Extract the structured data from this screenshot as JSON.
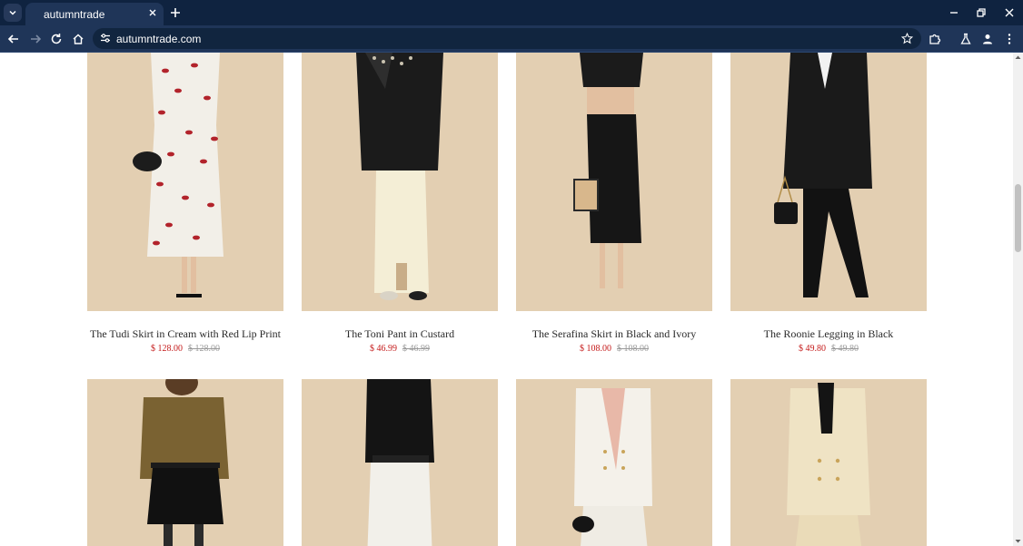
{
  "browser": {
    "tab_title": "autumntrade",
    "url": "autumntrade.com"
  },
  "products": [
    {
      "name": "The Tudi Skirt in Cream with Red Lip Print",
      "price": "$ 128.00",
      "original_price": "$ 128.00"
    },
    {
      "name": "The Toni Pant in Custard",
      "price": "$ 46.99",
      "original_price": "$ 46.99"
    },
    {
      "name": "The Serafina Skirt in Black and Ivory",
      "price": "$ 108.00",
      "original_price": "$ 108.00"
    },
    {
      "name": "The Roonie Legging in Black",
      "price": "$ 49.80",
      "original_price": "$ 49.80"
    }
  ],
  "colors": {
    "chrome_dark": "#0f2340",
    "chrome_toolbar": "#1f3558",
    "sale_price": "#c41a1a",
    "photo_backdrop": "#e3cfb2"
  }
}
